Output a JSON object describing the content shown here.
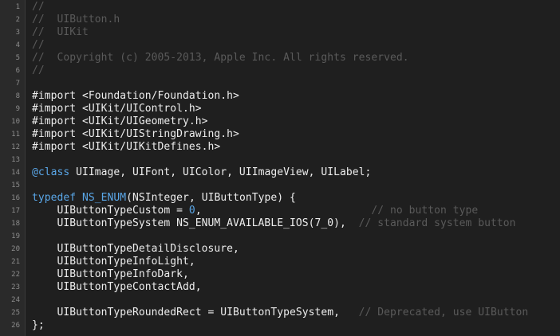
{
  "editor": {
    "lines": [
      {
        "number": "1",
        "text": "//",
        "type": "comment"
      },
      {
        "number": "2",
        "text": "//  UIButton.h",
        "type": "comment"
      },
      {
        "number": "3",
        "text": "//  UIKit",
        "type": "comment"
      },
      {
        "number": "4",
        "text": "//",
        "type": "comment"
      },
      {
        "number": "5",
        "text": "//  Copyright (c) 2005-2013, Apple Inc. All rights reserved.",
        "type": "comment"
      },
      {
        "number": "6",
        "text": "//",
        "type": "comment"
      },
      {
        "number": "7",
        "text": "",
        "type": "plain"
      },
      {
        "number": "8",
        "text": "#import <Foundation/Foundation.h>",
        "type": "plain"
      },
      {
        "number": "9",
        "text": "#import <UIKit/UIControl.h>",
        "type": "plain"
      },
      {
        "number": "10",
        "text": "#import <UIKit/UIGeometry.h>",
        "type": "plain"
      },
      {
        "number": "11",
        "text": "#import <UIKit/UIStringDrawing.h>",
        "type": "plain"
      },
      {
        "number": "12",
        "text": "#import <UIKit/UIKitDefines.h>",
        "type": "plain"
      },
      {
        "number": "13",
        "text": "",
        "type": "plain"
      },
      {
        "number": "14",
        "text": "@class UIImage, UIFont, UIColor, UIImageView, UILabel;",
        "type": "class"
      },
      {
        "number": "15",
        "text": "",
        "type": "plain"
      },
      {
        "number": "16",
        "text": "typedef NS_ENUM(NSInteger, UIButtonType) {",
        "type": "typedef"
      },
      {
        "number": "17",
        "text": "    UIButtonTypeCustom = 0,",
        "comment": "// no button type",
        "type": "custom"
      },
      {
        "number": "18",
        "text": "    UIButtonTypeSystem NS_ENUM_AVAILABLE_IOS(7_0),",
        "comment": "// standard system button",
        "type": "system"
      },
      {
        "number": "19",
        "text": "",
        "type": "plain"
      },
      {
        "number": "20",
        "text": "    UIButtonTypeDetailDisclosure,",
        "type": "plain"
      },
      {
        "number": "21",
        "text": "    UIButtonTypeInfoLight,",
        "type": "plain"
      },
      {
        "number": "22",
        "text": "    UIButtonTypeInfoDark,",
        "type": "plain"
      },
      {
        "number": "23",
        "text": "    UIButtonTypeContactAdd,",
        "type": "plain"
      },
      {
        "number": "24",
        "text": "",
        "type": "plain"
      },
      {
        "number": "25",
        "text": "    UIButtonTypeRoundedRect = UIButtonTypeSystem,",
        "comment": "// Deprecated, use UIButton",
        "type": "rounded"
      },
      {
        "number": "26",
        "text": "};",
        "type": "plain"
      }
    ]
  }
}
